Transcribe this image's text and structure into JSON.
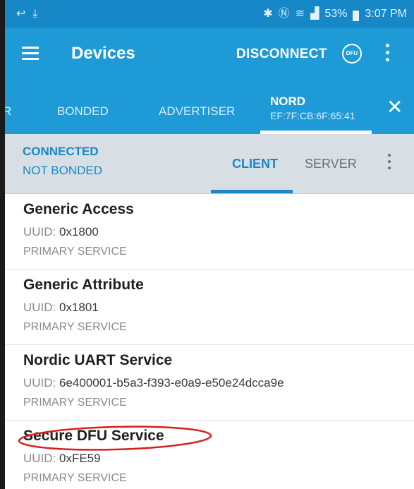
{
  "statusbar": {
    "battery": "53%",
    "time": "3:07 PM"
  },
  "appbar": {
    "title": "Devices",
    "disconnect_label": "DISCONNECT",
    "dfu_label": "DFU"
  },
  "tabs": {
    "partial": "R",
    "bonded": "BONDED",
    "advertiser": "ADVERTISER",
    "device_name": "NORD",
    "device_address": "EF:7F:CB:6F:65:41"
  },
  "connection": {
    "status": "CONNECTED",
    "bond": "NOT BONDED",
    "client_tab": "CLIENT",
    "server_tab": "SERVER"
  },
  "uuid_label": "UUID: ",
  "services": [
    {
      "name": "Generic Access",
      "uuid": "0x1800",
      "type": "PRIMARY SERVICE"
    },
    {
      "name": "Generic Attribute",
      "uuid": "0x1801",
      "type": "PRIMARY SERVICE"
    },
    {
      "name": "Nordic UART Service",
      "uuid": "6e400001-b5a3-f393-e0a9-e50e24dcca9e",
      "type": "PRIMARY SERVICE"
    },
    {
      "name": "Secure DFU Service",
      "uuid": "0xFE59",
      "type": "PRIMARY SERVICE"
    }
  ],
  "colors": {
    "accent": "#1e9ad6",
    "annotation": "#d62020"
  }
}
